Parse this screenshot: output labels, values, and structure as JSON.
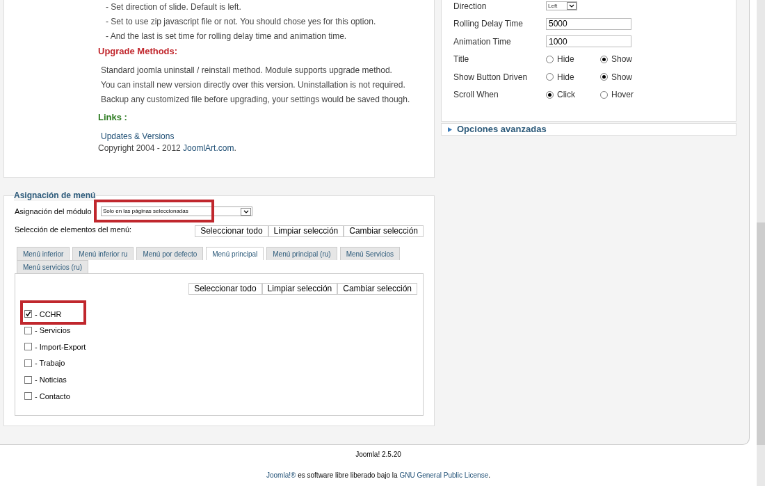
{
  "description": {
    "option_lines": [
      "- Set direction of slide. Default is left.",
      "- Set to use zip javascript file or not. You should chose yes for this option.",
      "- And the last is set time for rolling delay time and animation time."
    ],
    "upgrade_heading": "Upgrade Methods:",
    "upgrade_lines": [
      "Standard joomla uninstall / reinstall method. Module supports upgrade method.",
      "You can install new version directly over this version. Uninstallation is not required.",
      "Backup any customized file before upgrading, your settings would be saved though."
    ],
    "links_heading": "Links :",
    "link": "Updates & Versions",
    "copyright": {
      "before": "Copyright 2004 - 2012 ",
      "link": "JoomlArt.com",
      "after": "."
    }
  },
  "settings": [
    {
      "kind": "select",
      "label": "Direction",
      "value": "Left"
    },
    {
      "kind": "text",
      "label": "Rolling Delay Time",
      "value": "5000"
    },
    {
      "kind": "text",
      "label": "Animation Time",
      "value": "1000"
    },
    {
      "kind": "radio",
      "label": "Title",
      "options": [
        {
          "label": "Hide",
          "selected": false
        },
        {
          "label": "Show",
          "selected": true
        }
      ]
    },
    {
      "kind": "radio",
      "label": "Show Button Driven",
      "options": [
        {
          "label": "Hide",
          "selected": false
        },
        {
          "label": "Show",
          "selected": true
        }
      ]
    },
    {
      "kind": "radio",
      "label": "Scroll When",
      "options": [
        {
          "label": "Click",
          "selected": true
        },
        {
          "label": "Hover",
          "selected": false
        }
      ]
    }
  ],
  "advanced": {
    "label": "Opciones avanzadas",
    "expanded": false
  },
  "menu_assignment": {
    "legend": "Asignación de menú",
    "module_label": "Asignación del módulo",
    "module_value": "Solo en las páginas seleccionadas",
    "selection_label": "Selección de elementos del menú:",
    "buttons": [
      "Seleccionar todo",
      "Limpiar selección",
      "Cambiar selección"
    ],
    "tabs": [
      {
        "label": "Menú inferior",
        "selected": false
      },
      {
        "label": "Menú inferior ru",
        "selected": false
      },
      {
        "label": "Menú por defecto",
        "selected": false
      },
      {
        "label": "Menú principal",
        "selected": true
      },
      {
        "label": "Menú principal (ru)",
        "selected": false
      },
      {
        "label": "Menú Servicios",
        "selected": false
      },
      {
        "label": "Menú servicios (ru)",
        "selected": false
      }
    ],
    "panel_buttons": [
      "Seleccionar todo",
      "Limpiar selección",
      "Cambiar selección"
    ],
    "items": [
      {
        "label": "- CCHR",
        "checked": true,
        "highlighted": true
      },
      {
        "label": "- Servicios",
        "checked": false,
        "highlighted": false
      },
      {
        "label": "- Import-Export",
        "checked": false,
        "highlighted": false
      },
      {
        "label": "- Trabajo",
        "checked": false,
        "highlighted": false
      },
      {
        "label": "- Noticias",
        "checked": false,
        "highlighted": false
      },
      {
        "label": "- Contacto",
        "checked": false,
        "highlighted": false
      }
    ]
  },
  "footer": {
    "version": "Joomla! 2.5.20",
    "license": {
      "link": "Joomla!®",
      "middle": " es software libre liberado bajo la ",
      "link2": "GNU General Public License",
      "after": "."
    }
  }
}
